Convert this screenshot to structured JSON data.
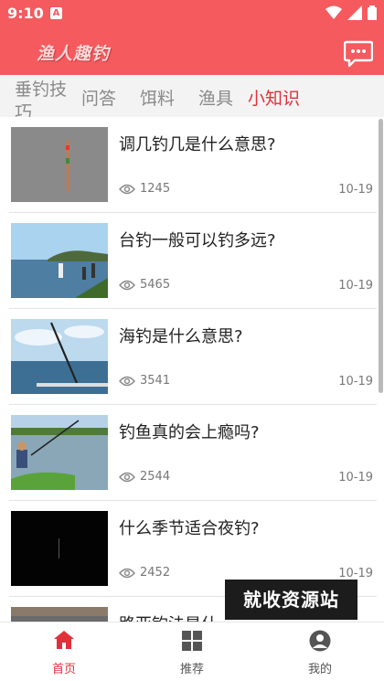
{
  "status": {
    "time": "9:10",
    "notif_letter": "A"
  },
  "app": {
    "title": "渔人趣钓"
  },
  "tabs": [
    {
      "label": "垂钓技巧",
      "active": false
    },
    {
      "label": "问答",
      "active": false
    },
    {
      "label": "饵料",
      "active": false
    },
    {
      "label": "渔具",
      "active": false
    },
    {
      "label": "小知识",
      "active": true
    }
  ],
  "articles": [
    {
      "title": "调几钓几是什么意思?",
      "views": "1245",
      "date": "10-19"
    },
    {
      "title": "台钓一般可以钓多远?",
      "views": "5465",
      "date": "10-19"
    },
    {
      "title": "海钓是什么意思?",
      "views": "3541",
      "date": "10-19"
    },
    {
      "title": "钓鱼真的会上瘾吗?",
      "views": "2544",
      "date": "10-19"
    },
    {
      "title": "什么季节适合夜钓?",
      "views": "2452",
      "date": "10-19"
    },
    {
      "title": "路亚钓法是什",
      "views": "",
      "date": ""
    }
  ],
  "watermark": "就收资源站",
  "bottom_nav": [
    {
      "label": "首页",
      "icon": "home-icon",
      "active": true
    },
    {
      "label": "推荐",
      "icon": "grid-icon",
      "active": false
    },
    {
      "label": "我的",
      "icon": "user-icon",
      "active": false
    }
  ],
  "colors": {
    "accent": "#f45a5e",
    "active_tab": "#e0303a"
  }
}
